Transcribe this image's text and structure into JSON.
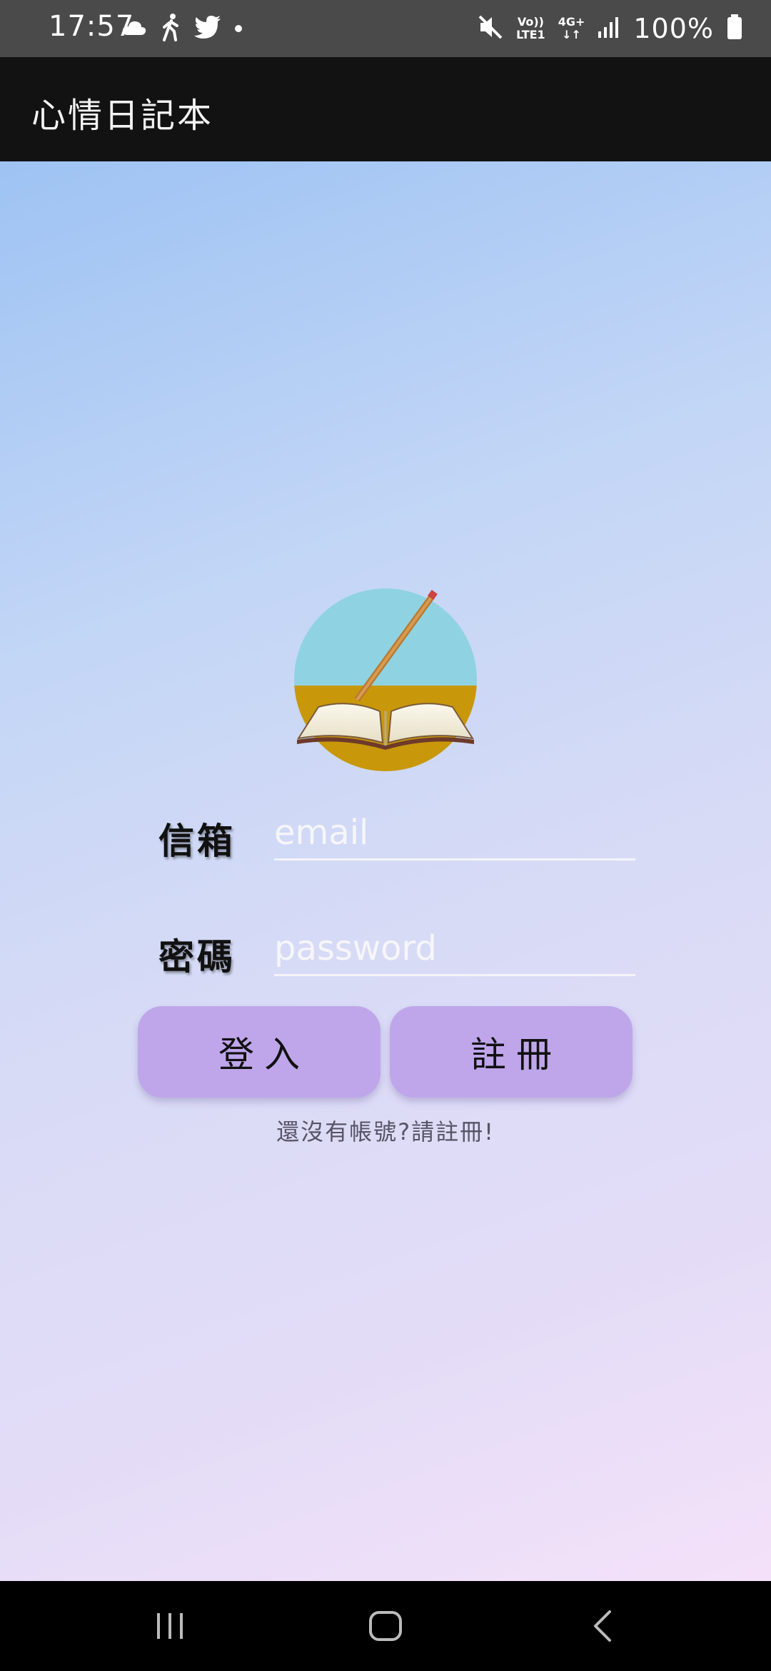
{
  "status_bar": {
    "time": "17:57",
    "network_type_top": "Vo))",
    "network_type_bottom": "LTE1",
    "data_type": "4G+",
    "battery": "100%",
    "left_icons": [
      "cloud-icon",
      "walking-icon",
      "twitter-icon",
      "dot-icon"
    ],
    "right_icons": [
      "mute-icon",
      "signal-icon",
      "battery-icon"
    ]
  },
  "app_bar": {
    "title": "心情日記本"
  },
  "login_form": {
    "email_label": "信箱",
    "email_placeholder": "email",
    "email_value": "",
    "password_label": "密碼",
    "password_placeholder": "password",
    "password_value": "",
    "login_button": "登入",
    "register_button": "註冊",
    "hint": "還沒有帳號?請註冊!"
  },
  "colors": {
    "button": "#bfa6ea",
    "app_bar": "#121212",
    "status_bar": "#4a4a4a",
    "logo_sky": "#8fd3e2",
    "logo_ground": "#c8980a"
  },
  "nav_bar": {
    "buttons": [
      "recents-icon",
      "home-icon",
      "back-icon"
    ]
  }
}
